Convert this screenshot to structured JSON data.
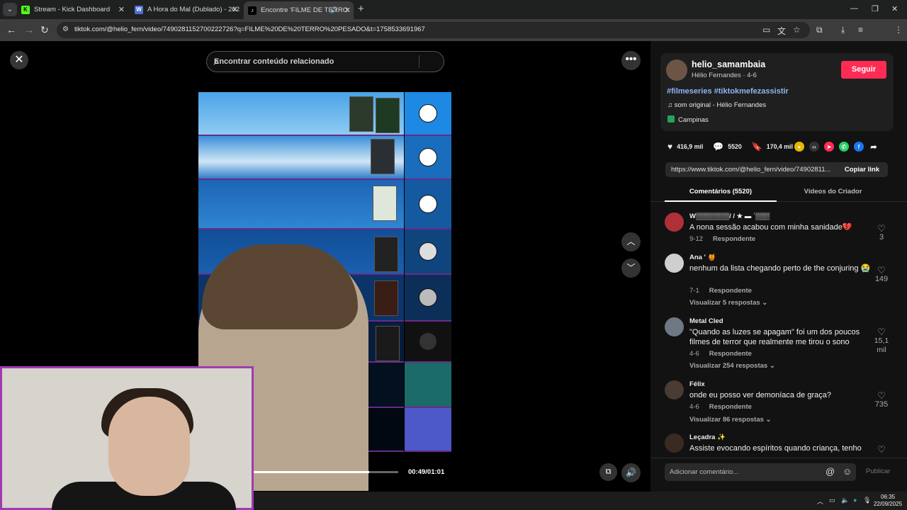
{
  "browser": {
    "tabs": [
      {
        "title": "Stream - Kick Dashboard",
        "icon": "kick-icon",
        "color": "#53fc18"
      },
      {
        "title": "A Hora do Mal (Dublado) - 202",
        "icon": "web-icon",
        "color": "#4a6fd1"
      },
      {
        "title": "Encontre 'FILME DE TERRO",
        "icon": "tiktok-icon",
        "color": "#ffffff"
      }
    ],
    "url": "tiktok.com/@helio_fern/video/7490281152700222726?q=FILME%20DE%20TERRO%20PESADO&t=1758533691967"
  },
  "video": {
    "search_placeholder": "Encontrar conteúdo relacionado",
    "time": "00:49/01:01",
    "progress": 0.8
  },
  "creator": {
    "username": "helio_samambaia",
    "display": "Hélio Fernandes · 4-6",
    "follow_label": "Seguir",
    "hashtags": "#filmeseries #tiktokmefezassistir",
    "sound": "som original - Hélio Fernandes",
    "location": "Campinas"
  },
  "stats": {
    "likes": "416,9 mil",
    "comments": "5520",
    "saves": "170,4 mil"
  },
  "link": {
    "url": "https://www.tiktok.com/@helio_fern/video/74902811...",
    "copy_label": "Copiar link"
  },
  "tabs": {
    "comments": "Comentários (5520)",
    "creator_videos": "Vídeos do Criador"
  },
  "comments": [
    {
      "name": "W▒▒▒▒▒▒▒/ / ★ ▬ ʿ▒▒▒",
      "text": "A nona sessão acabou com minha sanidade💔",
      "date": "9-12",
      "reply": "Respondente",
      "likes": "3",
      "replies": "",
      "avatar": "#b0303a"
    },
    {
      "name": "Ana ' 🍯",
      "text": "nenhum da lista chegando perto de the conjuring 😭",
      "date": "7-1",
      "reply": "Respondente",
      "likes": "149",
      "replies": "Visualizar 5 respostas",
      "avatar": "#cfcfcf"
    },
    {
      "name": "Metal Cled",
      "text": "\"Quando as luzes se apagam\" foi um dos poucos filmes de terror que realmente me tirou o sono",
      "date": "4-6",
      "reply": "Respondente",
      "likes": "15,1 mil",
      "replies": "Visualizar 254 respostas",
      "avatar": "#6f7884"
    },
    {
      "name": "Félix",
      "text": "onde eu posso ver demoníaca de graça?",
      "date": "4-6",
      "reply": "Respondente",
      "likes": "735",
      "replies": "Visualizar 86 respostas",
      "avatar": "#4a3b33"
    },
    {
      "name": "Leçadra ✨",
      "text": "Assiste evocando espíritos quando criança, tenho",
      "date": "",
      "reply": "",
      "likes": "",
      "replies": "",
      "avatar": "#3b2a22"
    }
  ],
  "comment_bar": {
    "placeholder": "Adicionar comentário...",
    "publish": "Publicar"
  },
  "taskbar": {
    "time": "06:35",
    "date": "22/09/2025"
  }
}
